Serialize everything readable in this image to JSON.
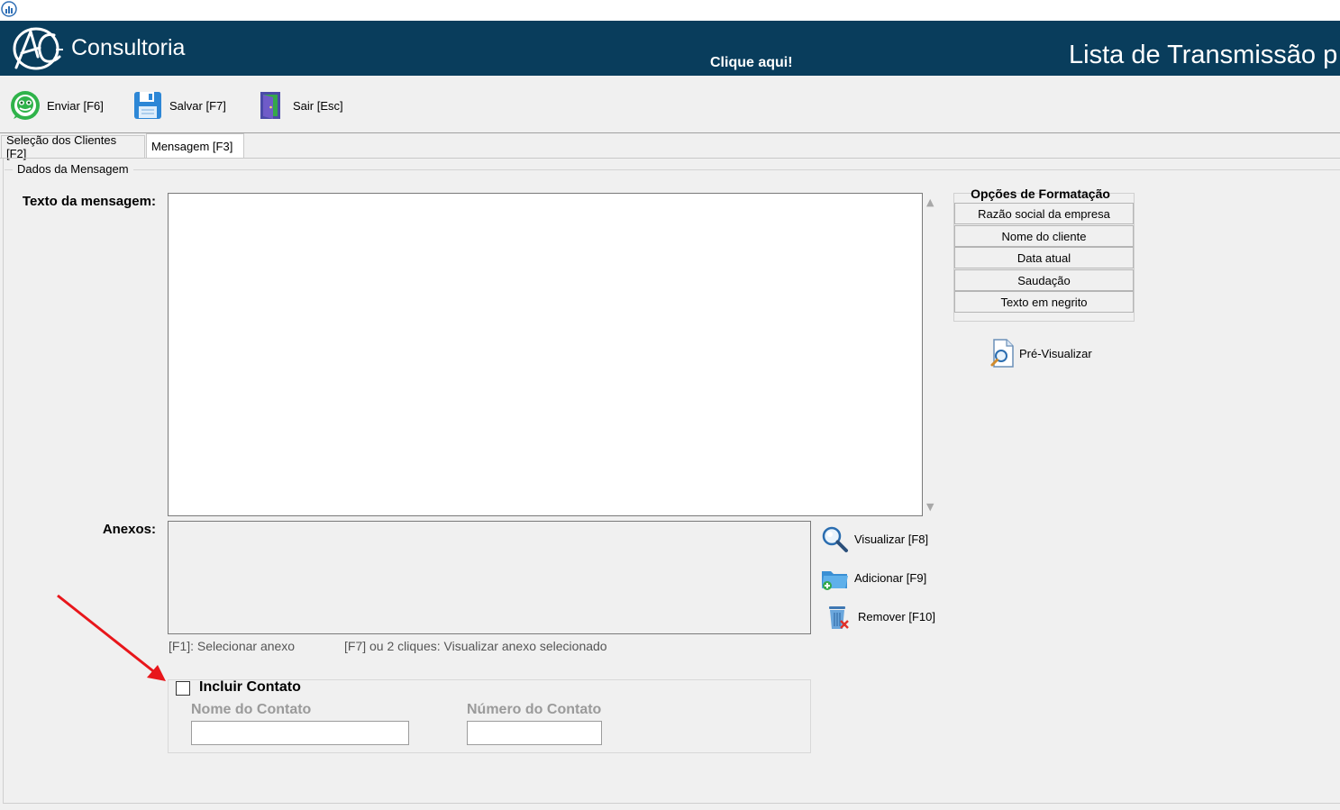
{
  "banner": {
    "brand": "Consultoria",
    "click_here": "Clique aqui!",
    "title": "Lista de Transmissão p"
  },
  "toolbar": {
    "send_label": "Enviar [F6]",
    "save_label": "Salvar [F7]",
    "exit_label": "Sair [Esc]"
  },
  "tabs": [
    {
      "label": "Seleção dos Clientes [F2]",
      "active": false
    },
    {
      "label": "Mensagem [F3]",
      "active": true
    }
  ],
  "group": {
    "label": "Dados da Mensagem"
  },
  "message": {
    "label": "Texto da mensagem:",
    "value": ""
  },
  "attachments": {
    "label": "Anexos:",
    "view_label": "Visualizar [F8]",
    "add_label": "Adicionar [F9]",
    "remove_label": "Remover [F10]",
    "hint_select": "[F1]: Selecionar anexo",
    "hint_view": "[F7] ou 2 cliques: Visualizar anexo selecionado"
  },
  "contact": {
    "checkbox_label": "Incluir Contato",
    "checked": false,
    "name_label": "Nome do Contato",
    "name_value": "",
    "number_label": "Número do Contato",
    "number_value": ""
  },
  "formatting": {
    "title": "Opções de Formatação",
    "items": [
      "Razão social da empresa",
      "Nome do cliente",
      "Data atual",
      "Saudação",
      "Texto em negrito"
    ]
  },
  "preview": {
    "label": "Pré-Visualizar"
  },
  "icons": {
    "app": "chart-icon",
    "send": "whatsapp-icon",
    "save": "floppy-disk-icon",
    "exit": "door-exit-icon",
    "view": "magnifier-icon",
    "add": "folder-add-icon",
    "remove": "trash-icon",
    "preview": "document-search-icon"
  },
  "colors": {
    "banner": "#093d5c",
    "workarea": "#f0f0f0",
    "annotation_arrow": "#e8161b"
  }
}
